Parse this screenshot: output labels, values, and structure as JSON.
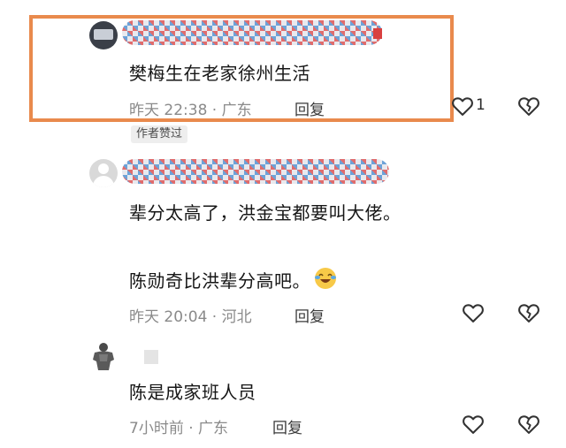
{
  "comments": [
    {
      "text": "樊梅生在老家徐州生活",
      "time": "昨天 22:38",
      "location": "广东",
      "reply_label": "回复",
      "like_count": "1",
      "author_badge": "作者赞过"
    },
    {
      "line1": "辈分太高了，洪金宝都要叫大佬。",
      "line2": "陈勋奇比洪辈分高吧。",
      "emoji": "laughing-crying-face",
      "time": "昨天 20:04",
      "location": "河北",
      "reply_label": "回复"
    },
    {
      "text": "陈是成家班人员",
      "time": "7小时前",
      "location": "广东",
      "reply_label": "回复"
    }
  ],
  "colors": {
    "highlight": "#e98a4d",
    "meta": "#8a8a8a"
  },
  "icons": [
    "like-heart-icon",
    "dislike-broken-heart-icon",
    "laughing-emoji-icon"
  ]
}
